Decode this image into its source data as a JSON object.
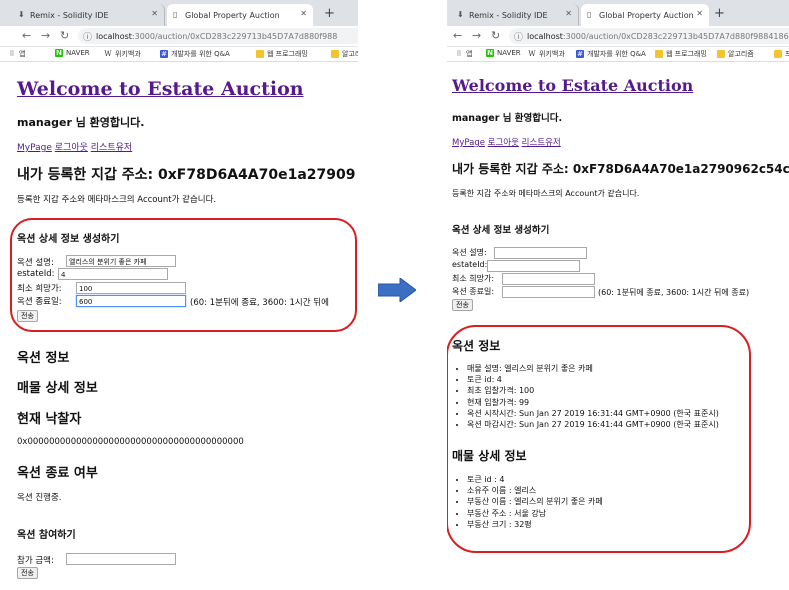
{
  "browser": {
    "tab1_title": "Remix - Solidity IDE",
    "tab2_title": "Global Property Auction",
    "new_tab": "+",
    "url_host": "localhost",
    "url_left": ":3000/auction/0xCD283c229713b45D7A7d880f988",
    "url_right": ":3000/auction/0xCD283c229713b45D7A7d880f9884186bb72a",
    "bookmarks": [
      "앱",
      "NAVER",
      "위키백과",
      "개발자를 위한 Q&A",
      "웹 프로그래밍",
      "알고리즘"
    ],
    "bookmarks_right_tail": "프"
  },
  "left": {
    "title": "Welcome to Estate Auction",
    "greeting": "manager 님 환영합니다.",
    "links": [
      "MyPage",
      "로그아웃",
      "리스트유저"
    ],
    "wallet_heading": "내가 등록한 지갑 주소: 0xF78D6A4A70e1a27909",
    "wallet_note": "등록한 지갑 주소와 메타마스크의 Account가 같습니다.",
    "form_heading": "옥션 상세 정보 생성하기",
    "fields": [
      {
        "label": "옥션 설명:",
        "value": "엘리스의 분위기 좋은 카페"
      },
      {
        "label": "estateId:",
        "value": "4"
      },
      {
        "label": "최소 희망가:",
        "value": "100"
      },
      {
        "label": "옥션 종료일:",
        "value": "600",
        "hint": "(60: 1분뒤에 종료, 3600: 1시간 뒤에"
      }
    ],
    "submit": "전송",
    "auction_info": "옥션 정보",
    "property_detail": "매물 상세 정보",
    "current_bidder": "현재 낙찰자",
    "bidder_address": "0x0000000000000000000000000000000000000000",
    "auction_end": "옥션 종료 여부",
    "auction_status": "옥션 진행중.",
    "join_heading": "옥션 참여하기",
    "bid_label": "참가 금액:",
    "bid_value": "",
    "bid_submit": "전송"
  },
  "right": {
    "title": "Welcome to Estate Auction",
    "greeting": "manager 님 환영합니다.",
    "links": [
      "MyPage",
      "로그아웃",
      "리스트유저"
    ],
    "wallet_heading": "내가 등록한 지갑 주소: 0xF78D6A4A70e1a2790962c54c",
    "wallet_note": "등록한 지갑 주소와 메타마스크의 Account가 같습니다.",
    "form_heading": "옥션 상세 정보 생성하기",
    "fields": [
      {
        "label": "옥션 설명:",
        "value": ""
      },
      {
        "label": "estateId:",
        "value": ""
      },
      {
        "label": "최소 희망가:",
        "value": ""
      },
      {
        "label": "옥션 종료일:",
        "value": "",
        "hint": "(60: 1분뒤에 종료, 3600: 1시간 뒤에 종료)"
      }
    ],
    "submit": "전송",
    "auction_info_heading": "옥션 정보",
    "auction_info": [
      "매물 설명: 엘리스의 분위기 좋은 카페",
      "토큰 id: 4",
      "최초 입찰가격: 100",
      "현재 입찰가격: 99",
      "옥션 시작시간: Sun Jan 27 2019 16:31:44 GMT+0900 (한국 표준시)",
      "옥션 마감시간: Sun Jan 27 2019 16:41:44 GMT+0900 (한국 표준시)"
    ],
    "property_heading": "매물 상세 정보",
    "property_info": [
      "토큰 id : 4",
      "소유주 이름 : 엘리스",
      "부동산 이름 : 엘리스의 분위기 좋은 카페",
      "부동산 주소 : 서울 강남",
      "부동산 크기 : 32평"
    ]
  },
  "colors": {
    "highlight_ring": "#d81e1e",
    "arrow": "#3a6fc4",
    "link": "#551a8b"
  }
}
